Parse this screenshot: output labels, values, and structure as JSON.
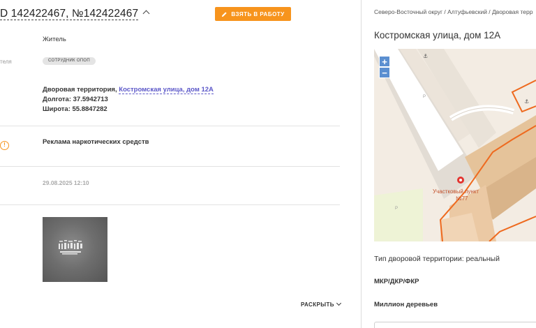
{
  "header": {
    "title_prefix": "D 142422467, №142422467",
    "take_button_label": "ВЗЯТЬ В РАБОТУ"
  },
  "details": {
    "role": "Житель",
    "side_label_partial": "теля",
    "badge": "СОТРУДНИК ОПОП",
    "territory_prefix": "Дворовая территория,",
    "territory_link": "Костромская улица, дом 12А",
    "longitude": "Долгота: 37.5942713",
    "latitude": "Широта: 55.8847282",
    "problem": "Реклама наркотических средств",
    "date": "29.08.2025 12:10",
    "expand_label": "РАСКРЫТЬ"
  },
  "right_panel": {
    "breadcrumbs": "Северо-Восточный округ / Алтуфьевский / Дворовая терр",
    "address_title": "Костромская улица, дом 12А",
    "map": {
      "zoom_in": "+",
      "zoom_out": "−",
      "poi_label_line1": "Участковый пункт",
      "poi_label_line2": "№77",
      "parking_symbol": "P"
    },
    "territory_type": "Тип дворовой территории: реальный",
    "mkr_label": "МКР/ДКР/ФКР",
    "million_trees_label": "Миллион деревьев"
  },
  "colors": {
    "accent_orange": "#f7941d",
    "link_purple": "#5b57c8",
    "zoom_blue": "#5b8fd0"
  }
}
